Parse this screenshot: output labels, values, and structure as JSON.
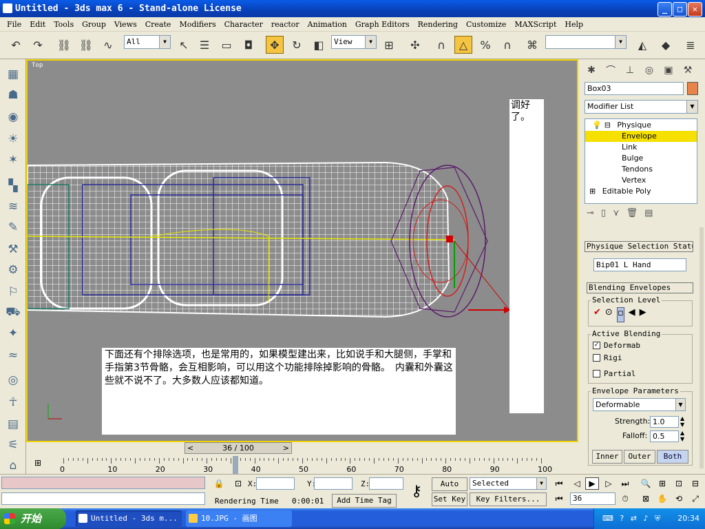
{
  "window": {
    "title": "Untitled - 3ds max 6 - Stand-alone License",
    "minimize": "_",
    "maximize": "□",
    "close": "✕"
  },
  "menu": [
    "File",
    "Edit",
    "Tools",
    "Group",
    "Views",
    "Create",
    "Modifiers",
    "Character",
    "reactor",
    "Animation",
    "Graph Editors",
    "Rendering",
    "Customize",
    "MAXScript",
    "Help"
  ],
  "toolbar": {
    "selection_filter": "All",
    "coord_system": "View"
  },
  "viewport": {
    "label": "Top"
  },
  "notes": {
    "main": "下面还有个排除选项，也是常用的，如果模型建出来，比如说手和大腿侧，手掌和手指第3节骨骼，会互相影响，可以用这个功能排除掉影响的骨骼。　内囊和外囊这些就不说不了。大多数人应该都知道。",
    "side": "调好了。"
  },
  "command_panel": {
    "object_name": "Box03",
    "color": "#e8834a",
    "modifier_list": "Modifier List",
    "stack": [
      {
        "label": "Physique",
        "level": 0,
        "expand": "⊟",
        "bulb": true
      },
      {
        "label": "Envelope",
        "level": 1,
        "selected": true
      },
      {
        "label": "Link",
        "level": 1
      },
      {
        "label": "Bulge",
        "level": 1
      },
      {
        "label": "Tendons",
        "level": 1
      },
      {
        "label": "Vertex",
        "level": 1
      },
      {
        "label": "Editable Poly",
        "level": 0,
        "expand": "⊞"
      }
    ],
    "rollout_selection": "Physique Selection Status",
    "selected_bone": "Bip01 L Hand",
    "rollout_blending": "Blending Envelopes",
    "selection_level": "Selection Level",
    "active_blending": "Active Blending",
    "deformable": "Deformab",
    "rigid": "Rigi",
    "partial": "Partial",
    "envelope_params": "Envelope Parameters",
    "envelope_type": "Deformable",
    "strength_label": "Strength:",
    "strength": "1.0",
    "falloff_label": "Falloff:",
    "falloff": "0.5",
    "inner": "Inner",
    "outer": "Outer",
    "both": "Both"
  },
  "timeline": {
    "slider": "36 / 100",
    "ticks": [
      "0",
      "10",
      "20",
      "30",
      "40",
      "50",
      "60",
      "70",
      "80",
      "90",
      "100"
    ],
    "current_frame": 36,
    "total_frames": 100
  },
  "status": {
    "x_label": "X:",
    "y_label": "Y:",
    "z_label": "Z:",
    "auto_key": "Auto Key",
    "set_key": "Set Key",
    "key_mode": "Selected",
    "key_filters": "Key Filters...",
    "frame": "36",
    "rendering_label": "Rendering Time",
    "rendering_time": "0:00:01",
    "add_time_tag": "Add Time Tag"
  },
  "taskbar": {
    "start": "开始",
    "tasks": [
      "Untitled - 3ds m...",
      "10.JPG - 画图"
    ],
    "clock": "20:34"
  }
}
